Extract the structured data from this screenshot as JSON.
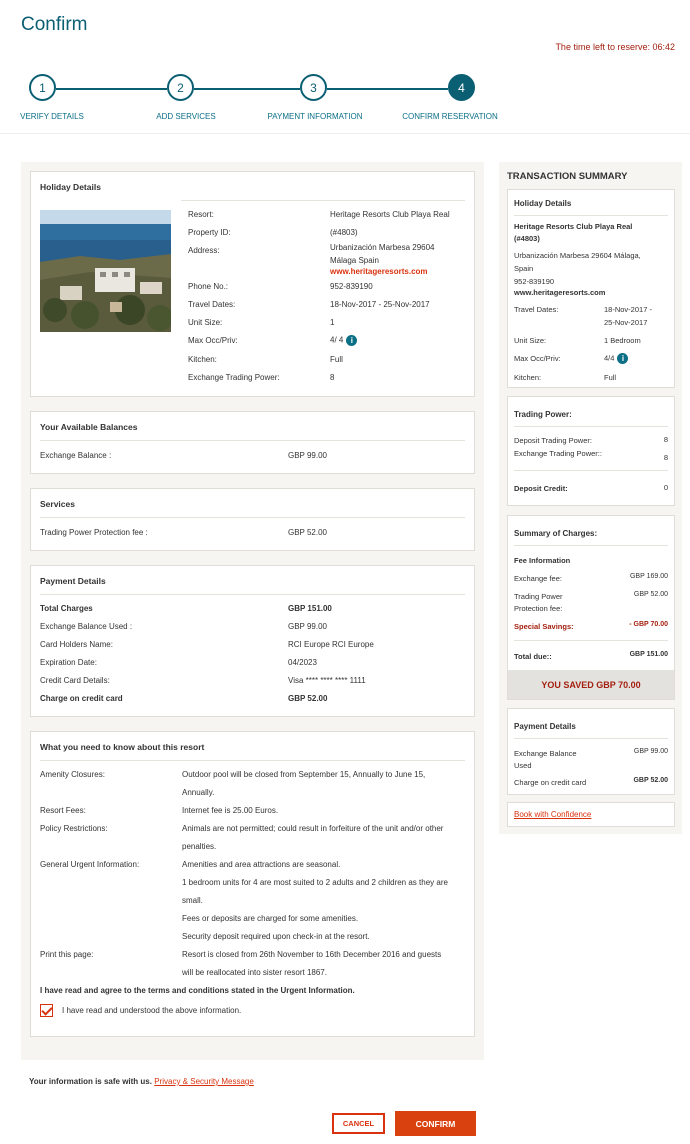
{
  "header": {
    "title": "Confirm",
    "timer": "The time left to reserve: 06:42"
  },
  "steps": [
    {
      "number": "1",
      "label": "VERIFY DETAILS",
      "active": false
    },
    {
      "number": "2",
      "label": "ADD SERVICES",
      "active": false
    },
    {
      "number": "3",
      "label": "PAYMENT INFORMATION",
      "active": false
    },
    {
      "number": "4",
      "label": "CONFIRM RESERVATION",
      "active": true
    }
  ],
  "holiday": {
    "title": "Holiday Details",
    "resort_label": "Resort:",
    "resort_value": "Heritage Resorts Club Playa Real",
    "property_label": "Property ID:",
    "property_value": "(#4803)",
    "address_label": "Address:",
    "address_line1": "Urbanización Marbesa 29604",
    "address_line2": "Málaga Spain",
    "website": "www.heritageresorts.com",
    "phone_label": "Phone No.:",
    "phone_value": "952-839190",
    "dates_label": "Travel Dates:",
    "dates_value": "18-Nov-2017 - 25-Nov-2017",
    "unit_label": "Unit Size:",
    "unit_value": "1",
    "occ_label": "Max Occ/Priv:",
    "occ_value": "4/ 4",
    "kitchen_label": "Kitchen:",
    "kitchen_value": "Full",
    "etp_label": "Exchange Trading Power:",
    "etp_value": "8"
  },
  "balances": {
    "title": "Your Available Balances",
    "label": "Exchange Balance :",
    "value": "GBP 99.00"
  },
  "services": {
    "title": "Services",
    "label": "Trading Power Protection fee :",
    "value": "GBP 52.00"
  },
  "payment": {
    "title": "Payment Details",
    "rows": [
      {
        "label": "Total Charges",
        "value": "GBP 151.00",
        "bold": true
      },
      {
        "label": "Exchange Balance Used :",
        "value": "GBP 99.00",
        "bold": false
      },
      {
        "label": "Card Holders Name:",
        "value": "RCI Europe RCI Europe",
        "bold": false
      },
      {
        "label": "Expiration Date:",
        "value": "04/2023",
        "bold": false
      },
      {
        "label": "Credit Card Details:",
        "value": "Visa **** **** **** 1111",
        "bold": false
      },
      {
        "label": "Charge on credit card",
        "value": "GBP 52.00",
        "bold": true
      }
    ]
  },
  "know": {
    "title": "What you need to know about this resort",
    "amenity_label": "Amenity Closures:",
    "amenity_l1": "Outdoor pool will be closed from September 15, Annually to June 15,",
    "amenity_l2": "Annually.",
    "fees_label": "Resort Fees:",
    "fees_value": "Internet fee is 25.00 Euros.",
    "policy_label": "Policy Restrictions:",
    "policy_l1": "Animals are not permitted; could result in forfeiture of the unit and/or other",
    "policy_l2": "penalties.",
    "urgent_label": "General Urgent Information:",
    "urgent_l1": "Amenities and area attractions are seasonal.",
    "urgent_l2": "1 bedroom units for 4 are most suited to 2 adults and 2 children as they are",
    "urgent_l3": "small.",
    "urgent_l4": "Fees or deposits are charged for some amenities.",
    "urgent_l5": "Security deposit required upon check-in at the resort.",
    "print_label": "Print this page:",
    "print_l1": "Resort is closed from 26th November to 16th December 2016 and guests",
    "print_l2": "will be reallocated into sister resort 1867.",
    "agree_text": "I have read and agree to the terms and conditions stated in the Urgent Information.",
    "checkbox_label": "I have read and understood the above information."
  },
  "summary": {
    "title": "TRANSACTION SUMMARY",
    "holiday_title": "Holiday Details",
    "resort_name_l1": "Heritage Resorts Club Playa Real",
    "resort_name_l2": "(#4803)",
    "address_l1": "Urbanización Marbesa 29604 Málaga,",
    "address_l2": "Spain",
    "phone": "952-839190",
    "website": "www.heritageresorts.com",
    "dates_label": "Travel Dates:",
    "dates_l1": "18-Nov-2017 -",
    "dates_l2": "25-Nov-2017",
    "unit_label": "Unit Size:",
    "unit_value": "1  Bedroom",
    "occ_label": "Max Occ/Priv:",
    "occ_value": "4/4",
    "kitchen_label": "Kitchen:",
    "kitchen_value": "Full",
    "tp_title": "Trading Power:",
    "dtp_label": "Deposit Trading Power:",
    "dtp_value": "8",
    "etp_label": "Exchange Trading Power::",
    "etp_value": "8",
    "dc_label": "Deposit Credit:",
    "dc_value": "0",
    "charges_title": "Summary of Charges:",
    "fee_info": "Fee Information",
    "exch_fee_label": "Exchange fee:",
    "exch_fee_value": "GBP 169.00",
    "tpp_label_l1": "Trading Power",
    "tpp_label_l2": "Protection fee:",
    "tpp_value": "GBP 52.00",
    "savings_label": "Special Savings:",
    "savings_value": "- GBP 70.00",
    "total_label": "Total due::",
    "total_value": "GBP 151.00",
    "saved_text": "YOU SAVED GBP 70.00",
    "pay_title": "Payment Details",
    "eb_label_l1": "Exchange Balance",
    "eb_label_l2": "Used",
    "eb_value": "GBP 99.00",
    "cc_label": "Charge on credit card",
    "cc_value": "GBP 52.00",
    "book_link": "Book with Confidence"
  },
  "footer": {
    "safe_text": "Your information is safe with us.",
    "privacy_link": "Privacy & Security Message",
    "cancel_label": "CANCEL",
    "confirm_label": "CONFIRM"
  },
  "colors": {
    "teal": "#0b5f73",
    "orange": "#d9420e",
    "red": "#a31f0f"
  }
}
